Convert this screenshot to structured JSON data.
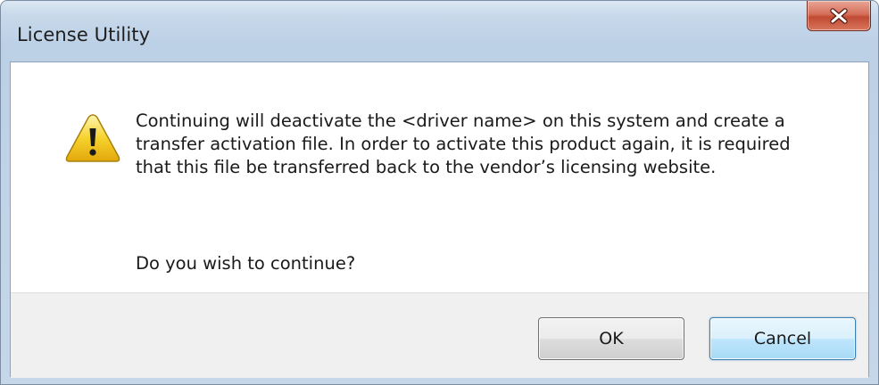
{
  "window": {
    "title": "License Utility",
    "close_icon": "close-x-icon"
  },
  "dialog": {
    "icon": "warning-icon",
    "message": "Continuing will deactivate the <driver name> on this system and create a\ntransfer activation file. In order to activate this product again, it is required\nthat this file be transferred back to the vendor’s licensing website.",
    "question": "Do you wish to continue?"
  },
  "buttons": {
    "ok_label": "OK",
    "cancel_label": "Cancel"
  },
  "colors": {
    "title_bar": "#c7d8ea",
    "close_button": "#c14a33",
    "footer": "#f0f0f0",
    "default_button_border": "#3c7fb1",
    "warning_yellow": "#f6d22d"
  }
}
